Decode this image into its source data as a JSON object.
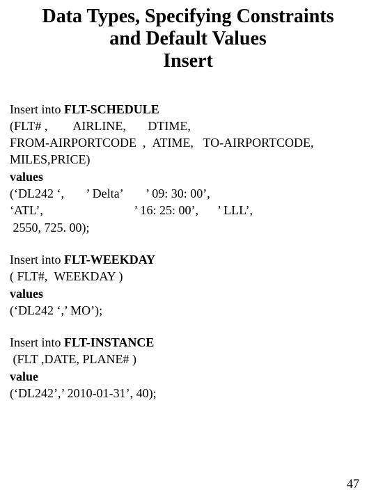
{
  "title_line1": "Data Types, Specifying Constraints",
  "title_line2": "and Default Values",
  "title_line3": "Insert",
  "block1": {
    "l1a": "Insert into ",
    "l1b": "FLT-SCHEDULE",
    "l2": "(FLT# ,        AIRLINE,       DTIME,",
    "l3": "FROM-AIRPORTCODE  ,  ATIME,   TO-AIRPORTCODE,",
    "l4": "MILES,PRICE)",
    "l5": "values",
    "l6": "(‘DL242 ‘,       ’ Delta’       ’ 09: 30: 00’,",
    "l7": "‘ATL’,                             ’ 16: 25: 00’,      ’ LLL’,",
    "l8": " 2550, 725. 00);"
  },
  "block2": {
    "l1a": "Insert into ",
    "l1b": "FLT-WEEKDAY",
    "l2": "( FLT#,  WEEKDAY )",
    "l3": "values",
    "l4": "(‘DL242 ‘,’ MO’);"
  },
  "block3": {
    "l1a": "Insert into ",
    "l1b": "FLT-INSTANCE",
    "l2": " (FLT ,DATE, PLANE# )",
    "l3": "value",
    "l4": "(‘DL242’,’ 2010-01-31’, 40);"
  },
  "page_number": "47"
}
